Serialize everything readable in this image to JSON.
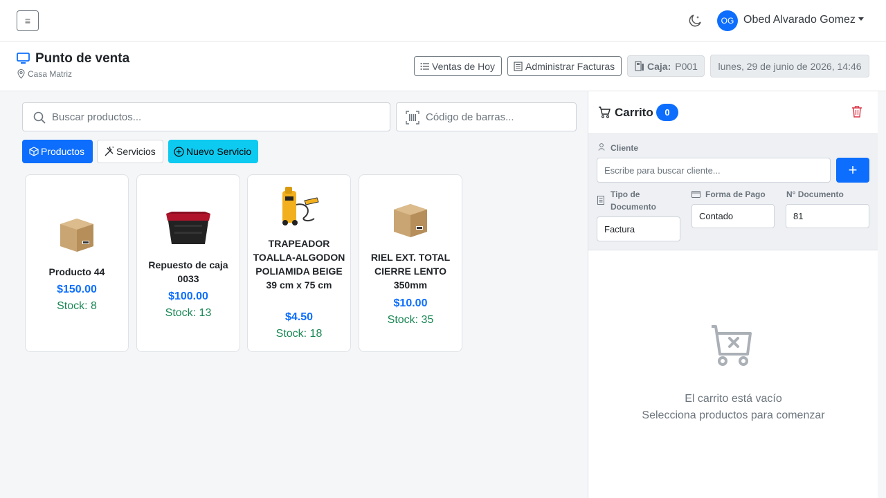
{
  "topbar": {
    "menu_icon": "hamburger-icon",
    "theme_icon": "moon-stars-icon",
    "user_initials": "OG",
    "user_name": "Obed Alvarado Gomez"
  },
  "header": {
    "title": "Punto de venta",
    "title_icon": "monitor-icon",
    "location": "Casa Matriz",
    "location_icon": "map-pin-icon",
    "ventas_hoy_label": "Ventas de Hoy",
    "administrar_facturas_label": "Administrar Facturas",
    "caja_label": "Caja:",
    "caja_value": "P001",
    "datetime": "lunes, 29 de junio de 2026, 14:46"
  },
  "search": {
    "placeholder": "Buscar productos...",
    "barcode_placeholder": "Código de barras..."
  },
  "tabs": {
    "productos": "Productos",
    "servicios": "Servicios",
    "nuevo_servicio": "Nuevo Servicio"
  },
  "products": [
    {
      "name": "Producto 44",
      "price": "$150.00",
      "stock": "Stock: 8",
      "image": "cardboard-box"
    },
    {
      "name": "Repuesto de caja 0033",
      "price": "$100.00",
      "stock": "Stock: 13",
      "image": "storage-tote"
    },
    {
      "name": "TRAPEADOR TOALLA-ALGODON POLIAMIDA BEIGE 39 cm x 75 cm",
      "price": "$4.50",
      "stock": "Stock: 18",
      "image": "pressure-washer"
    },
    {
      "name": "RIEL EXT. TOTAL CIERRE LENTO 350mm",
      "price": "$10.00",
      "stock": "Stock: 35",
      "image": "cardboard-box"
    }
  ],
  "cart": {
    "title": "Carrito",
    "count": "0",
    "cliente_label": "Cliente",
    "cliente_placeholder": "Escribe para buscar cliente...",
    "add_label": "+",
    "tipo_documento_label": "Tipo de Documento",
    "tipo_documento_value": "Factura",
    "forma_pago_label": "Forma de Pago",
    "forma_pago_value": "Contado",
    "numero_documento_label": "N° Documento",
    "numero_documento_value": "81",
    "empty_title": "El carrito está vacío",
    "empty_subtitle": "Selecciona productos para comenzar"
  },
  "colors": {
    "primary": "#0d6efd",
    "info": "#0dcaf0",
    "success": "#198754",
    "danger": "#dc3545"
  }
}
